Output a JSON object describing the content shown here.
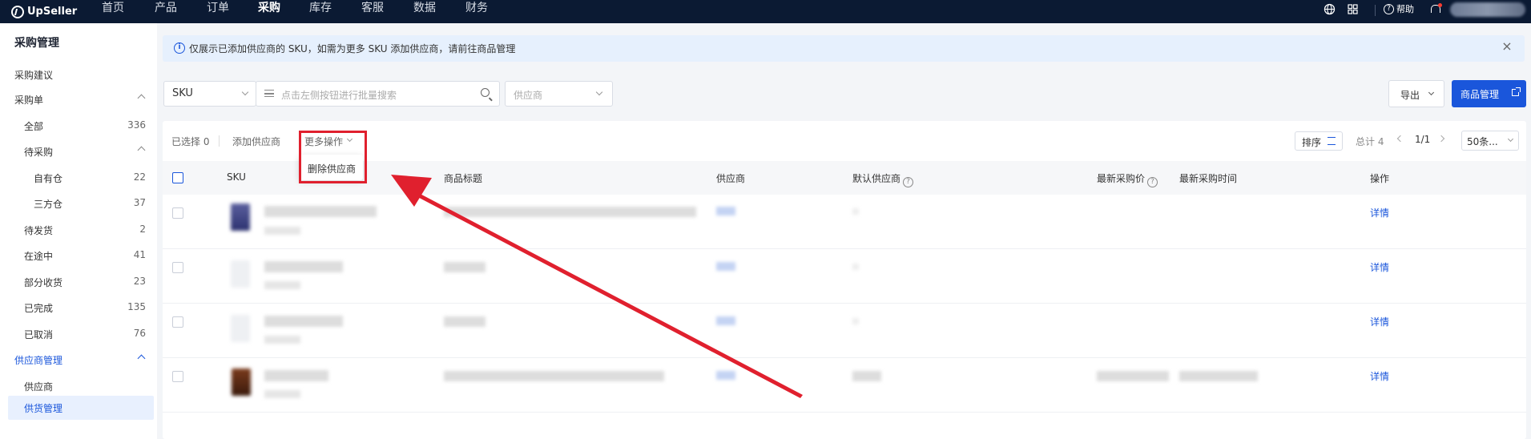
{
  "app": {
    "logo": "UpSeller"
  },
  "topnav": {
    "items": [
      "首页",
      "产品",
      "订单",
      "采购",
      "库存",
      "客服",
      "数据",
      "财务"
    ],
    "active": "采购",
    "help": "帮助"
  },
  "sidebar": {
    "title": "采购管理",
    "items": [
      {
        "label": "采购建议"
      },
      {
        "label": "采购单"
      },
      {
        "label": "全部",
        "count": "336"
      },
      {
        "label": "待采购"
      },
      {
        "label": "自有仓",
        "count": "22"
      },
      {
        "label": "三方仓",
        "count": "37"
      },
      {
        "label": "待发货",
        "count": "2"
      },
      {
        "label": "在途中",
        "count": "41"
      },
      {
        "label": "部分收货",
        "count": "23"
      },
      {
        "label": "已完成",
        "count": "135"
      },
      {
        "label": "已取消",
        "count": "76"
      },
      {
        "label": "供应商管理"
      },
      {
        "label": "供应商"
      },
      {
        "label": "供货管理"
      }
    ]
  },
  "banner": {
    "text": "仅展示已添加供应商的 SKU，如需为更多 SKU 添加供应商，请前往商品管理"
  },
  "filters": {
    "sku_type": "SKU",
    "search_placeholder": "点击左侧按钮进行批量搜索",
    "supplier_placeholder": "供应商"
  },
  "actions": {
    "export": "导出",
    "goods_manage": "商品管理"
  },
  "toolbar": {
    "selected": "已选择 0",
    "add_supplier": "添加供应商",
    "more": "更多操作",
    "dropdown_item": "删除供应商",
    "sort": "排序",
    "total": "总计 4",
    "page": "1/1",
    "page_size": "50条..."
  },
  "table": {
    "columns": [
      "SKU",
      "商品标题",
      "供应商",
      "默认供应商",
      "最新采购价",
      "最新采购时间",
      "操作"
    ],
    "rows": [
      {
        "detail": "详情"
      },
      {
        "detail": "详情"
      },
      {
        "detail": "详情"
      },
      {
        "detail": "详情"
      }
    ]
  },
  "colors": {
    "accent": "#1a56db",
    "nav_bg": "#0b1a33",
    "highlight": "#e0202e"
  }
}
